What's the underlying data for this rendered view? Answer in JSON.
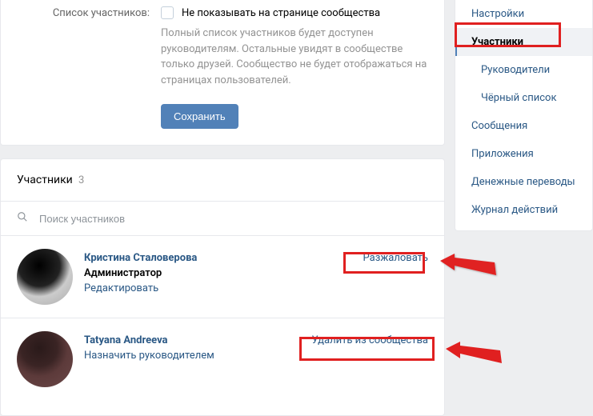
{
  "settings": {
    "field_label": "Список участников:",
    "checkbox_label": "Не показывать на странице сообщества",
    "help_text": "Полный список участников будет доступен руководителям. Остальные увидят в сообществе только друзей. Сообщество не будет отображаться на страницах пользователей.",
    "save_button": "Сохранить"
  },
  "participants": {
    "title": "Участники",
    "count": "3",
    "search_placeholder": "Поиск участников",
    "members": [
      {
        "name": "Кристина Сталоверова",
        "role": "Администратор",
        "action_secondary": "Редактировать",
        "action_primary": "Разжаловать"
      },
      {
        "name": "Tatyana Andreeva",
        "role": "",
        "action_secondary": "Назначить руководителем",
        "action_primary": "Удалить из сообщества"
      }
    ]
  },
  "sidebar": {
    "items": [
      {
        "label": "Настройки",
        "sub": false,
        "active": false
      },
      {
        "label": "Участники",
        "sub": false,
        "active": true
      },
      {
        "label": "Руководители",
        "sub": true,
        "active": false
      },
      {
        "label": "Чёрный список",
        "sub": true,
        "active": false
      },
      {
        "label": "Сообщения",
        "sub": false,
        "active": false
      },
      {
        "label": "Приложения",
        "sub": false,
        "active": false
      },
      {
        "label": "Денежные переводы",
        "sub": false,
        "active": false
      },
      {
        "label": "Журнал действий",
        "sub": false,
        "active": false
      }
    ]
  }
}
